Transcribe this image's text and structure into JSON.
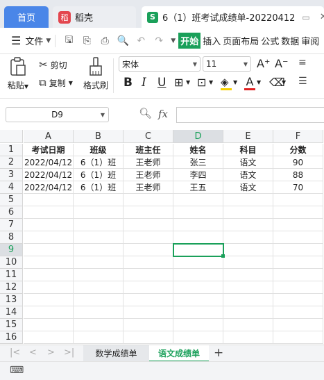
{
  "tabs": {
    "home": "首页",
    "shell": "稻壳",
    "doc_title": "6（1）班考试成绩单-20220412",
    "doc_icon": "S",
    "shell_icon": "稻"
  },
  "menu": {
    "file": "文件",
    "start": "开始",
    "insert": "插入",
    "page_layout": "页面布局",
    "formula": "公式",
    "data": "数据",
    "review": "审阅"
  },
  "ribbon": {
    "paste": "粘贴",
    "cut": "剪切",
    "copy": "复制",
    "format_painter": "格式刷",
    "font_name": "宋体",
    "font_size": "11"
  },
  "formula_bar": {
    "name_box": "D9",
    "fx": "fx",
    "formula": ""
  },
  "grid": {
    "columns": [
      "A",
      "B",
      "C",
      "D",
      "E",
      "F"
    ],
    "selected_column": "D",
    "selected_row": "9",
    "rows": [
      {
        "num": "1",
        "cells": [
          "考试日期",
          "班级",
          "班主任",
          "姓名",
          "科目",
          "分数"
        ]
      },
      {
        "num": "2",
        "cells": [
          "2022/04/12",
          "6（1）班",
          "王老师",
          "张三",
          "语文",
          "90"
        ]
      },
      {
        "num": "3",
        "cells": [
          "2022/04/12",
          "6（1）班",
          "王老师",
          "李四",
          "语文",
          "88"
        ]
      },
      {
        "num": "4",
        "cells": [
          "2022/04/12",
          "6（1）班",
          "王老师",
          "王五",
          "语文",
          "70"
        ]
      },
      {
        "num": "5",
        "cells": [
          "",
          "",
          "",
          "",
          "",
          ""
        ]
      },
      {
        "num": "6",
        "cells": [
          "",
          "",
          "",
          "",
          "",
          ""
        ]
      },
      {
        "num": "7",
        "cells": [
          "",
          "",
          "",
          "",
          "",
          ""
        ]
      },
      {
        "num": "8",
        "cells": [
          "",
          "",
          "",
          "",
          "",
          ""
        ]
      },
      {
        "num": "9",
        "cells": [
          "",
          "",
          "",
          "",
          "",
          ""
        ]
      },
      {
        "num": "10",
        "cells": [
          "",
          "",
          "",
          "",
          "",
          ""
        ]
      },
      {
        "num": "11",
        "cells": [
          "",
          "",
          "",
          "",
          "",
          ""
        ]
      },
      {
        "num": "12",
        "cells": [
          "",
          "",
          "",
          "",
          "",
          ""
        ]
      },
      {
        "num": "13",
        "cells": [
          "",
          "",
          "",
          "",
          "",
          ""
        ]
      },
      {
        "num": "14",
        "cells": [
          "",
          "",
          "",
          "",
          "",
          ""
        ]
      },
      {
        "num": "15",
        "cells": [
          "",
          "",
          "",
          "",
          "",
          ""
        ]
      },
      {
        "num": "16",
        "cells": [
          "",
          "",
          "",
          "",
          "",
          ""
        ]
      }
    ]
  },
  "sheets": {
    "tab1": "数学成绩单",
    "tab2": "语文成绩单",
    "active": "语文成绩单"
  },
  "colors": {
    "accent_green": "#1aa05a",
    "home_tab": "#4a86e8"
  }
}
